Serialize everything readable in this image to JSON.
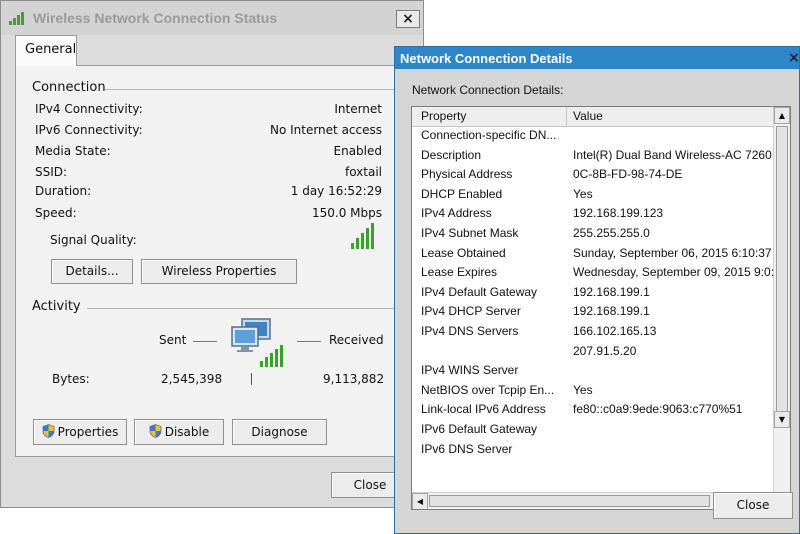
{
  "status_window": {
    "title": "Wireless Network Connection Status",
    "close_glyph": "×",
    "tab_general": "General",
    "connection": {
      "group_label": "Connection",
      "rows": [
        {
          "label": "IPv4 Connectivity:",
          "value": "Internet"
        },
        {
          "label": "IPv6 Connectivity:",
          "value": "No Internet access"
        },
        {
          "label": "Media State:",
          "value": "Enabled"
        },
        {
          "label": "SSID:",
          "value": "foxtail"
        },
        {
          "label": "Duration:",
          "value": "1 day 16:52:29"
        },
        {
          "label": "Speed:",
          "value": "150.0 Mbps"
        }
      ],
      "signal_quality_label": "Signal Quality:",
      "signal_bars_lit": 5,
      "details_button": "Details...",
      "wireless_properties_button": "Wireless Properties"
    },
    "activity": {
      "group_label": "Activity",
      "sent_label": "Sent",
      "received_label": "Received",
      "bytes_label": "Bytes:",
      "bytes_sent": "2,545,398",
      "bytes_received": "9,113,882"
    },
    "buttons": {
      "properties": "Properties",
      "disable": "Disable",
      "diagnose": "Diagnose",
      "close": "Close"
    }
  },
  "details_window": {
    "title": "Network Connection Details",
    "close_glyph": "×",
    "heading": "Network Connection Details:",
    "columns": {
      "property": "Property",
      "value": "Value"
    },
    "rows": [
      {
        "property": "Connection-specific DN...",
        "value": ""
      },
      {
        "property": "Description",
        "value": "Intel(R) Dual Band Wireless-AC 7260"
      },
      {
        "property": "Physical Address",
        "value": "0C-8B-FD-98-74-DE"
      },
      {
        "property": "DHCP Enabled",
        "value": "Yes"
      },
      {
        "property": "IPv4 Address",
        "value": "192.168.199.123"
      },
      {
        "property": "IPv4 Subnet Mask",
        "value": "255.255.255.0"
      },
      {
        "property": "Lease Obtained",
        "value": "Sunday, September 06, 2015 6:10:37"
      },
      {
        "property": "Lease Expires",
        "value": "Wednesday, September 09, 2015 9:0:"
      },
      {
        "property": "IPv4 Default Gateway",
        "value": "192.168.199.1"
      },
      {
        "property": "IPv4 DHCP Server",
        "value": "192.168.199.1"
      },
      {
        "property": "IPv4 DNS Servers",
        "value": "166.102.165.13"
      },
      {
        "property": "",
        "value": "207.91.5.20"
      },
      {
        "property": "IPv4 WINS Server",
        "value": ""
      },
      {
        "property": "NetBIOS over Tcpip En...",
        "value": "Yes"
      },
      {
        "property": "Link-local IPv6 Address",
        "value": "fe80::c0a9:9ede:9063:c770%51"
      },
      {
        "property": "IPv6 Default Gateway",
        "value": ""
      },
      {
        "property": "IPv6 DNS Server",
        "value": ""
      }
    ],
    "close_button": "Close"
  },
  "icons": {
    "title_signal": "wifi-signal-icon",
    "shield": "uac-shield-icon",
    "network": "network-computers-icon"
  },
  "colors": {
    "signal_green": "#3aa12a",
    "details_title_bar": "#2e86c8"
  }
}
